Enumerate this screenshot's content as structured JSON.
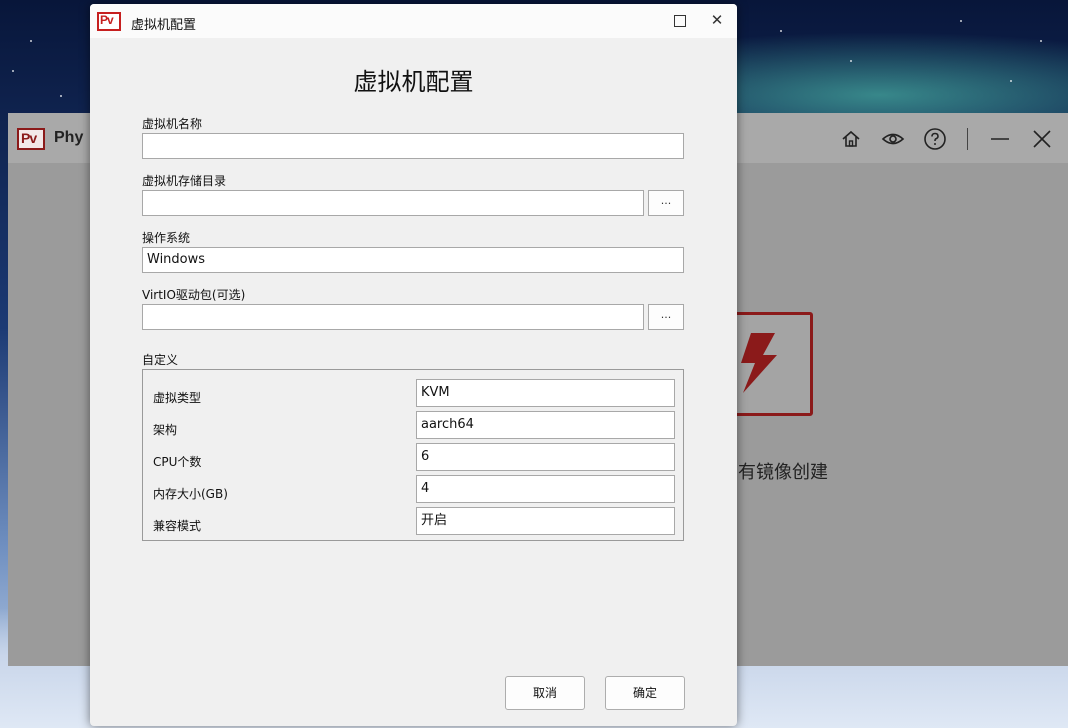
{
  "background_app": {
    "title": "Phy",
    "logo_text": "Pv",
    "empty_text": "有镜像创建",
    "controls": [
      "home-icon",
      "eye-icon",
      "help-icon",
      "minimize-icon",
      "close-icon"
    ]
  },
  "dialog": {
    "logo_text": "Pv",
    "window_title": "虚拟机配置",
    "heading": "虚拟机配置",
    "name_label": "虚拟机名称",
    "name_value": "",
    "storage_label": "虚拟机存储目录",
    "storage_value": "",
    "browse_label": "...",
    "os_label": "操作系统",
    "os_value": "Windows",
    "virtio_label": "VirtIO驱动包(可选)",
    "virtio_value": "",
    "custom_label": "自定义",
    "custom": {
      "virt_type_label": "虚拟类型",
      "virt_type_value": "KVM",
      "arch_label": "架构",
      "arch_value": "aarch64",
      "cpu_label": "CPU个数",
      "cpu_value": "6",
      "memory_label": "内存大小(GB)",
      "memory_value": "4",
      "compat_label": "兼容模式",
      "compat_value": "开启"
    },
    "cancel_label": "取消",
    "ok_label": "确定"
  },
  "colors": {
    "brand_red": "#c61f1f",
    "dialog_bg": "#f0f0f0"
  }
}
